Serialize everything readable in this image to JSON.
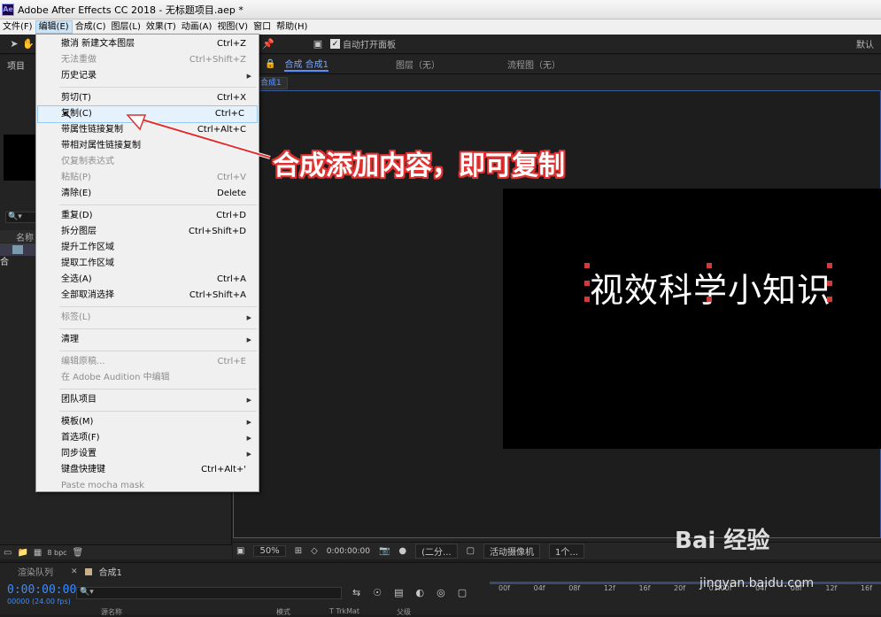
{
  "window": {
    "title": "Adobe After Effects CC 2018 - 无标题项目.aep *",
    "logo": "Ae"
  },
  "menubar": {
    "items": [
      "文件(F)",
      "编辑(E)",
      "合成(C)",
      "图层(L)",
      "效果(T)",
      "动画(A)",
      "视图(V)",
      "窗口",
      "帮助(H)"
    ]
  },
  "toolbar": {
    "auto_open_label": "自动打开面板",
    "workspace_label": "默认"
  },
  "project_panel": {
    "tab_label": "项目",
    "col_name": "名称",
    "item_label": "合",
    "search_icon": "🔍▾",
    "bpc": "8 bpc"
  },
  "comp_panel": {
    "tabs": [
      "合成 合成1",
      "图层（无）",
      "流程图（无）"
    ],
    "breadcrumb": "合成1",
    "canvas_text": "视效科学小知识",
    "zoom": "50%",
    "timecode": "0:00:00:00",
    "resolution": "(二分...",
    "camera": "活动摄像机",
    "views": "1个..."
  },
  "edit_menu": {
    "items": [
      {
        "label": "撤消 新建文本图层",
        "shortcut": "Ctrl+Z",
        "disabled": false
      },
      {
        "label": "无法重做",
        "shortcut": "Ctrl+Shift+Z",
        "disabled": true
      },
      {
        "label": "历史记录",
        "shortcut": "",
        "disabled": false,
        "submenu": true
      },
      {
        "sep": true
      },
      {
        "label": "剪切(T)",
        "shortcut": "Ctrl+X",
        "disabled": false
      },
      {
        "label": "复制(C)",
        "shortcut": "Ctrl+C",
        "disabled": false,
        "highlighted": true
      },
      {
        "label": "带属性链接复制",
        "shortcut": "Ctrl+Alt+C",
        "disabled": false
      },
      {
        "label": "带相对属性链接复制",
        "shortcut": "",
        "disabled": false
      },
      {
        "label": "仅复制表达式",
        "shortcut": "",
        "disabled": true
      },
      {
        "label": "粘贴(P)",
        "shortcut": "Ctrl+V",
        "disabled": true
      },
      {
        "label": "清除(E)",
        "shortcut": "Delete",
        "disabled": false
      },
      {
        "sep": true
      },
      {
        "label": "重复(D)",
        "shortcut": "Ctrl+D",
        "disabled": false
      },
      {
        "label": "拆分图层",
        "shortcut": "Ctrl+Shift+D",
        "disabled": false
      },
      {
        "label": "提升工作区域",
        "shortcut": "",
        "disabled": false
      },
      {
        "label": "提取工作区域",
        "shortcut": "",
        "disabled": false
      },
      {
        "label": "全选(A)",
        "shortcut": "Ctrl+A",
        "disabled": false
      },
      {
        "label": "全部取消选择",
        "shortcut": "Ctrl+Shift+A",
        "disabled": false
      },
      {
        "sep": true
      },
      {
        "label": "标签(L)",
        "shortcut": "",
        "disabled": true,
        "submenu": true
      },
      {
        "sep": true
      },
      {
        "label": "清理",
        "shortcut": "",
        "disabled": false,
        "submenu": true
      },
      {
        "sep": true
      },
      {
        "label": "编辑原稿...",
        "shortcut": "Ctrl+E",
        "disabled": true
      },
      {
        "label": "在 Adobe Audition 中编辑",
        "shortcut": "",
        "disabled": true
      },
      {
        "sep": true
      },
      {
        "label": "团队项目",
        "shortcut": "",
        "disabled": false,
        "submenu": true
      },
      {
        "sep": true
      },
      {
        "label": "模板(M)",
        "shortcut": "",
        "disabled": false,
        "submenu": true
      },
      {
        "label": "首选项(F)",
        "shortcut": "",
        "disabled": false,
        "submenu": true
      },
      {
        "label": "同步设置",
        "shortcut": "",
        "disabled": false,
        "submenu": true
      },
      {
        "label": "键盘快捷键",
        "shortcut": "Ctrl+Alt+'",
        "disabled": false
      },
      {
        "label": "Paste mocha mask",
        "shortcut": "",
        "disabled": true
      }
    ]
  },
  "bottom_tabs": [
    "渲染队列",
    "合成1"
  ],
  "timeline": {
    "timecode": "0:00:00:00",
    "timecode_sub": "00000 (24.00 fps)",
    "ruler": [
      "00f",
      "04f",
      "08f",
      "12f",
      "16f",
      "20f",
      "01:00f",
      "04f",
      "08f",
      "12f",
      "16f"
    ],
    "col_source": "源名称",
    "col_mode": "模式",
    "col_trkmat": "T TrkMat",
    "col_parent": "父级"
  },
  "annotation": {
    "text": "合成添加内容，即可复制"
  },
  "watermark": {
    "brand": "Bai 经验",
    "url": "jingyan.baidu.com"
  }
}
